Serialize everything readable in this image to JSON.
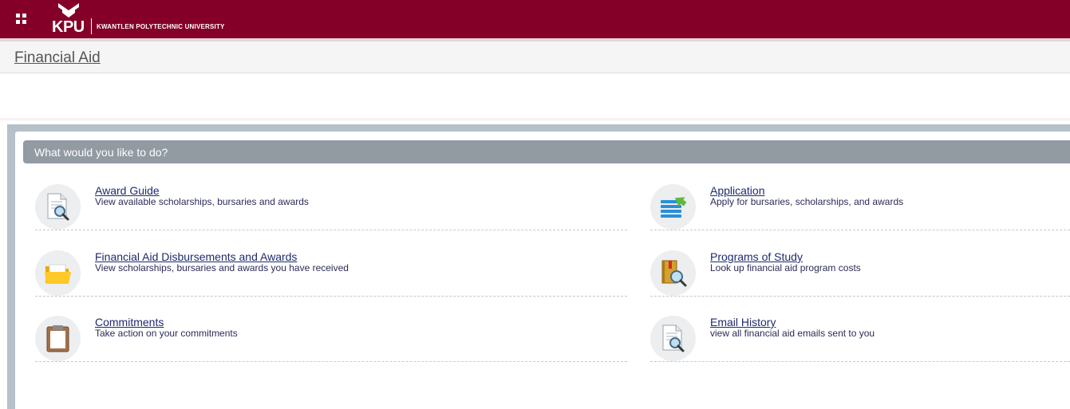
{
  "header": {
    "logo_text": "KPU",
    "university_name": "KWANTLEN POLYTECHNIC UNIVERSITY"
  },
  "page": {
    "title": "Financial Aid"
  },
  "panel": {
    "heading": "What would you like to do?",
    "items": [
      {
        "title": "Award Guide",
        "description": "View available scholarships, bursaries and awards",
        "icon": "document-search-icon"
      },
      {
        "title": "Application",
        "description": "Apply for bursaries, scholarships, and awards",
        "icon": "list-arrow-icon"
      },
      {
        "title": "Financial Aid Disbursements and Awards",
        "description": "View scholarships, bursaries and awards you have received",
        "icon": "folder-icon"
      },
      {
        "title": "Programs of Study",
        "description": "Look up financial aid program costs",
        "icon": "book-search-icon"
      },
      {
        "title": "Commitments",
        "description": "Take action on your commitments",
        "icon": "clipboard-icon"
      },
      {
        "title": "Email History",
        "description": "view all financial aid emails sent to you",
        "icon": "document-search-icon"
      }
    ]
  },
  "colors": {
    "brand": "#850029",
    "panel_header": "#929aa2",
    "link": "#1e2a6d"
  }
}
